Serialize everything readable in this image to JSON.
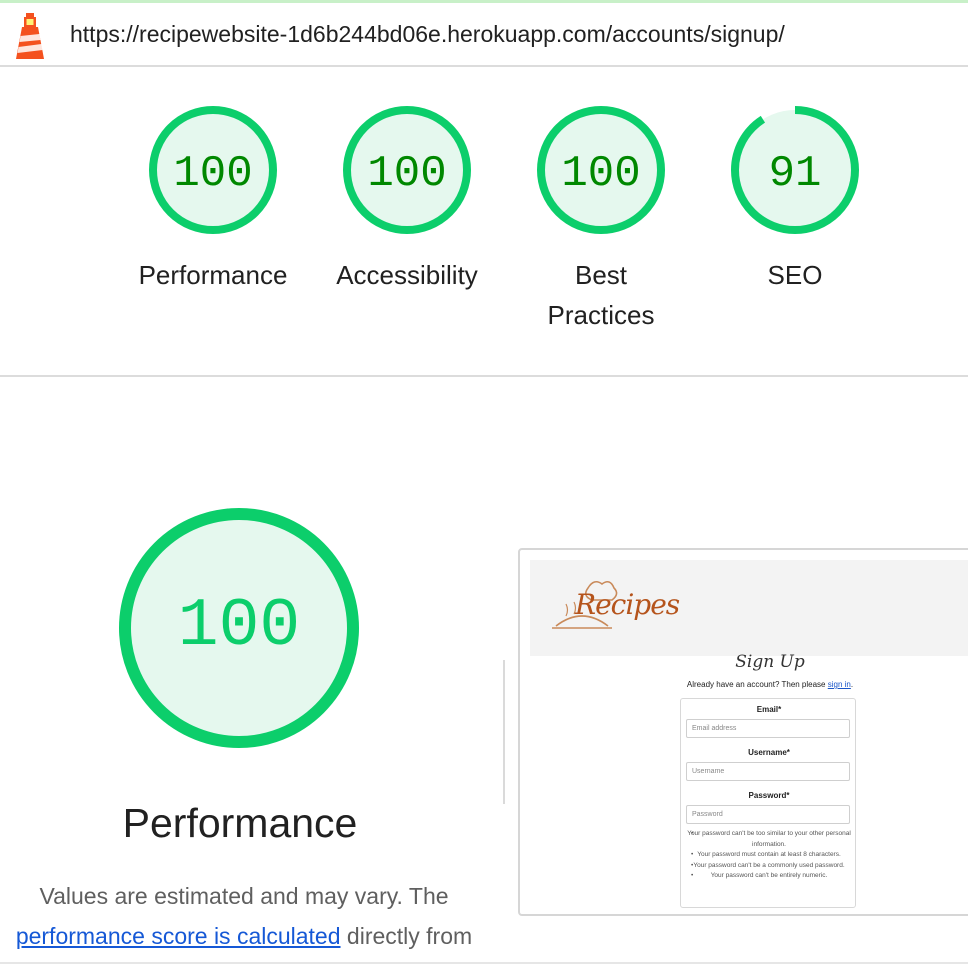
{
  "url": "https://recipewebsite-1d6b244bd06e.herokuapp.com/accounts/signup/",
  "colors": {
    "pass": "#0cce6b",
    "pass_text": "#008800",
    "pass_fill": "#e5f8ee",
    "link": "#1558d6"
  },
  "icons": {
    "logo": "lighthouse-icon"
  },
  "gauges": [
    {
      "score": "100",
      "label": "Performance",
      "value": 100
    },
    {
      "score": "100",
      "label": "Accessibility",
      "value": 100
    },
    {
      "score": "100",
      "label": "Best Practices",
      "value": 100
    },
    {
      "score": "91",
      "label": "SEO",
      "value": 91
    }
  ],
  "main": {
    "score": "100",
    "value": 100,
    "title": "Performance",
    "desc_prefix": "Values are estimated and may vary. The ",
    "desc_link": "performance score is calculated",
    "desc_suffix": " directly from"
  },
  "screenshot": {
    "logo_text": "Recipes",
    "title": "Sign Up",
    "already_prefix": "Already have an account? Then please ",
    "already_link": "sign in",
    "already_suffix": ".",
    "email_label": "Email*",
    "email_placeholder": "Email address",
    "username_label": "Username*",
    "username_placeholder": "Username",
    "password_label": "Password*",
    "password_placeholder": "Password",
    "help": [
      "Your password can't be too similar to your other personal information.",
      "Your password must contain at least 8 characters.",
      "Your password can't be a commonly used password.",
      "Your password can't be entirely numeric."
    ]
  }
}
